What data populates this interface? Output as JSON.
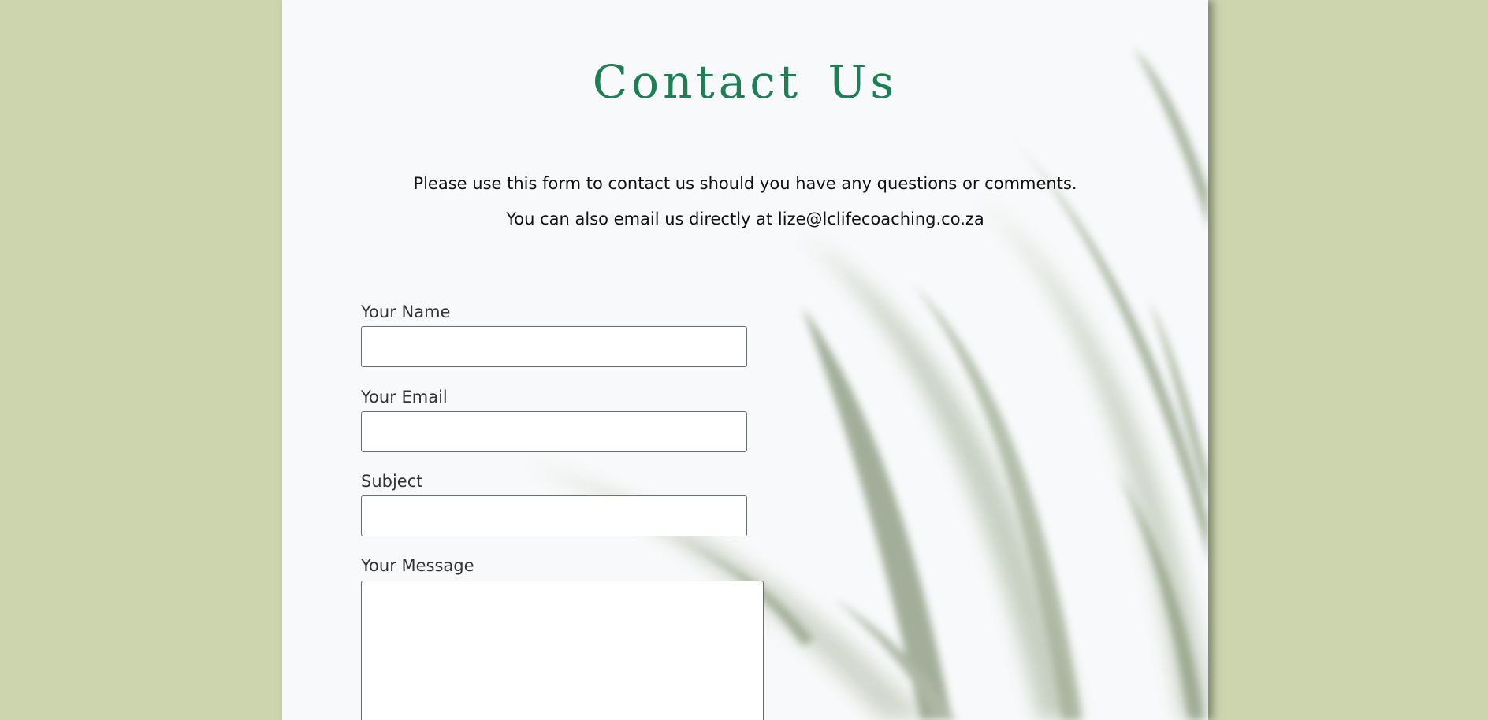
{
  "page": {
    "title": "Contact Us",
    "intro_line1": "Please use this form to contact us should you have any questions or comments.",
    "intro_line2": "You can also email us directly at lize@lclifecoaching.co.za"
  },
  "form": {
    "name_label": "Your Name",
    "name_value": "",
    "email_label": "Your Email",
    "email_value": "",
    "subject_label": "Subject",
    "subject_value": "",
    "message_label": "Your Message",
    "message_value": ""
  },
  "colors": {
    "outer_background": "#cdd5af",
    "page_background": "#f8f9fa",
    "title_accent": "#1e7e56",
    "leaf_green": "#8c9c7e"
  },
  "decoration": {
    "background_image": "blurred-green-leaves"
  }
}
